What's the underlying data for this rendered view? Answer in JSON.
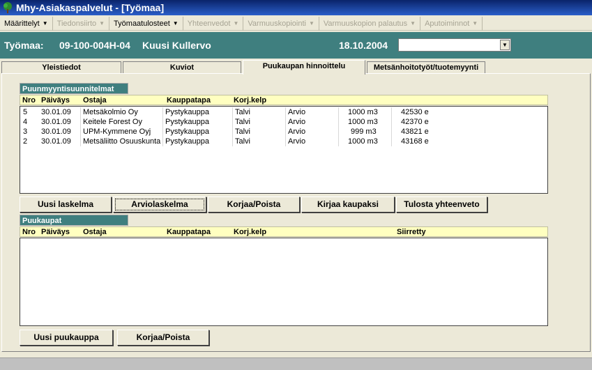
{
  "window": {
    "title": "Mhy-Asiakaspalvelut - [Työmaa]"
  },
  "menu": [
    {
      "label": "Määrittelyt",
      "enabled": true
    },
    {
      "label": "Tiedonsiirto",
      "enabled": false
    },
    {
      "label": "Työmaatulosteet",
      "enabled": true
    },
    {
      "label": "Yhteenvedot",
      "enabled": false
    },
    {
      "label": "Varmuuskopiointi",
      "enabled": false
    },
    {
      "label": "Varmuuskopion palautus",
      "enabled": false
    },
    {
      "label": "Aputoiminnot",
      "enabled": false
    }
  ],
  "header": {
    "label": "Työmaa:",
    "id": "09-100-004H-04",
    "name": "Kuusi Kullervo",
    "date": "18.10.2004",
    "combo_value": ""
  },
  "tabs": [
    {
      "label": "Yleistiedot"
    },
    {
      "label": "Kuviot"
    },
    {
      "label": "Puukaupan hinnoittelu"
    },
    {
      "label": "Metsänhoitotyöt/tuotemyynti"
    }
  ],
  "plans": {
    "title": "Puunmyyntisuunnitelmat",
    "columns": [
      "Nro",
      "Päiväys",
      "Ostaja",
      "Kauppatapa",
      "Korj.kelp"
    ],
    "rows": [
      {
        "nro": "5",
        "date": "30.01.09",
        "buyer": "Metsäkolmio Oy",
        "method": "Pystykauppa",
        "season": "Talvi",
        "type": "Arvio",
        "volume": "1000 m3",
        "price": "42530 e"
      },
      {
        "nro": "4",
        "date": "30.01.09",
        "buyer": "Keitele Forest Oy",
        "method": "Pystykauppa",
        "season": "Talvi",
        "type": "Arvio",
        "volume": "1000 m3",
        "price": "42370 e"
      },
      {
        "nro": "3",
        "date": "30.01.09",
        "buyer": "UPM-Kymmene Oyj",
        "method": "Pystykauppa",
        "season": "Talvi",
        "type": "Arvio",
        "volume": "999 m3",
        "price": "43821 e"
      },
      {
        "nro": "2",
        "date": "30.01.09",
        "buyer": "Metsäliitto Osuuskunta",
        "method": "Pystykauppa",
        "season": "Talvi",
        "type": "Arvio",
        "volume": "1000 m3",
        "price": "43168 e"
      }
    ],
    "buttons": {
      "new": "Uusi laskelma",
      "estimate": "Arviolaskelma",
      "edit": "Korjaa/Poista",
      "book": "Kirjaa kaupaksi",
      "print": "Tulosta yhteenveto"
    }
  },
  "sales": {
    "title": "Puukaupat",
    "columns": [
      "Nro",
      "Päiväys",
      "Ostaja",
      "Kauppatapa",
      "Korj.kelp",
      "Siirretty"
    ],
    "buttons": {
      "new": "Uusi puukauppa",
      "edit": "Korjaa/Poista"
    }
  }
}
